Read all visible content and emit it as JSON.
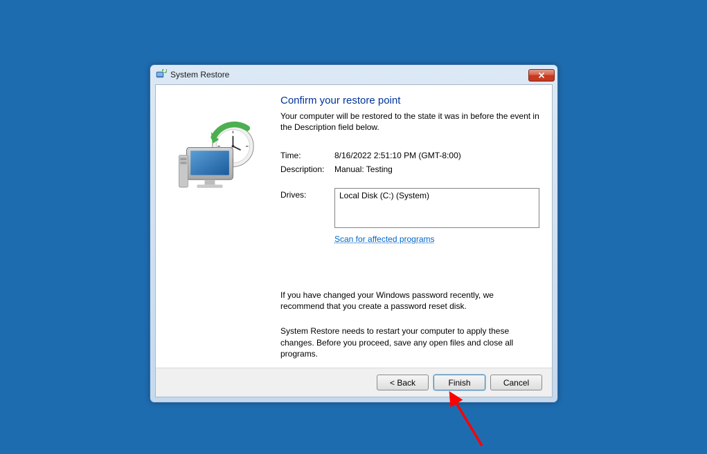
{
  "window": {
    "title": "System Restore"
  },
  "main": {
    "heading": "Confirm your restore point",
    "subtitle": "Your computer will be restored to the state it was in before the event in the Description field below.",
    "time_label": "Time:",
    "time_value": "8/16/2022 2:51:10 PM (GMT-8:00)",
    "description_label": "Description:",
    "description_value": "Manual: Testing",
    "drives_label": "Drives:",
    "drives": [
      "Local Disk (C:) (System)"
    ],
    "scan_link": "Scan for affected programs",
    "note_password": "If you have changed your Windows password recently, we recommend that you create a password reset disk.",
    "note_restart": "System Restore needs to restart your computer to apply these changes. Before you proceed, save any open files and close all programs."
  },
  "buttons": {
    "back": "< Back",
    "finish": "Finish",
    "cancel": "Cancel"
  }
}
